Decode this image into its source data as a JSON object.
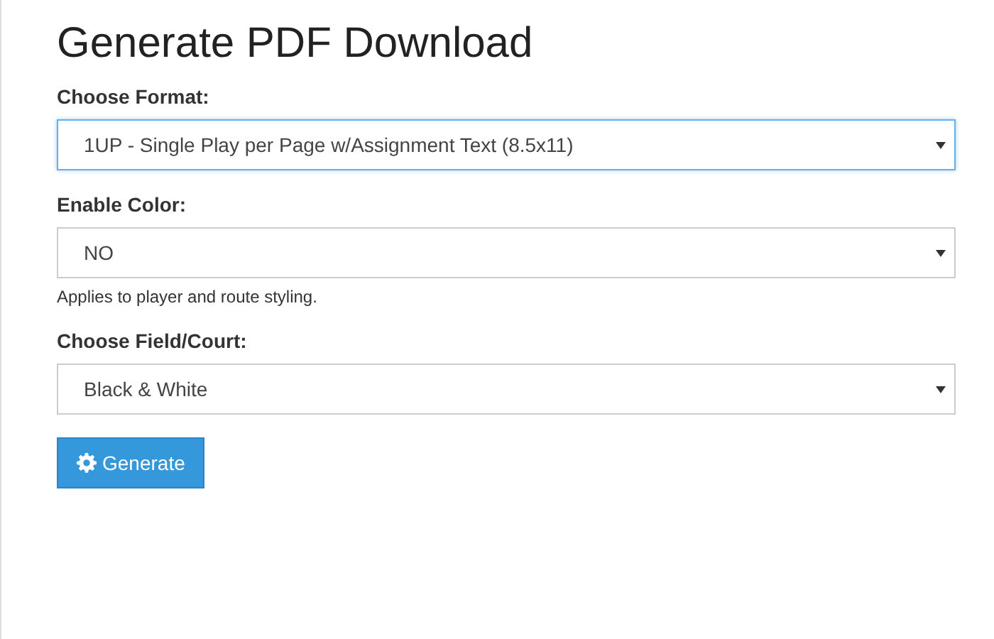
{
  "title": "Generate PDF Download",
  "fields": [
    {
      "label": "Choose Format:",
      "value": "1UP - Single Play per Page w/Assignment Text (8.5x11)",
      "focused": true
    },
    {
      "label": "Enable Color:",
      "value": "NO",
      "focused": false,
      "help": "Applies to player and route styling."
    },
    {
      "label": "Choose Field/Court:",
      "value": "Black & White",
      "focused": false
    }
  ],
  "button": {
    "label": "Generate"
  }
}
